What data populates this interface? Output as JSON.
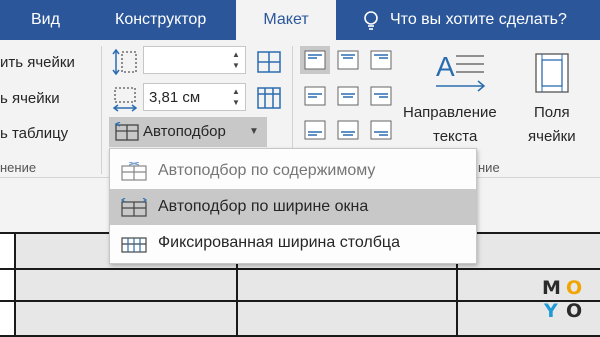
{
  "tabs": {
    "view": "Вид",
    "design": "Конструктор",
    "layout": "Макет",
    "tell_me": "Что вы хотите сделать?"
  },
  "ribbon": {
    "merge_cells": "ить ячейки",
    "split_cells": "ь ячейки",
    "split_table": "ь таблицу",
    "merge_group_label": "нение",
    "height_value": "",
    "width_value": "3,81 см",
    "autofit_label": "Автоподбор",
    "direction_line1": "Направление",
    "direction_line2": "текста",
    "margins_line1": "Поля",
    "margins_line2": "ячейки",
    "alignment_group_label": "ние"
  },
  "autofit_menu": {
    "items": [
      {
        "label": "Автоподбор по содержимому",
        "highlighted": false,
        "enabled": false
      },
      {
        "label": "Автоподбор по ширине окна",
        "highlighted": true,
        "enabled": true
      },
      {
        "label": "Фиксированная ширина столбца",
        "highlighted": false,
        "enabled": true
      }
    ]
  },
  "watermark": {
    "letters": [
      "M",
      "O",
      "Y",
      "O"
    ],
    "colors": [
      "#2b2b2b",
      "#f0a500",
      "#1e9bd7",
      "#2b2b2b"
    ]
  },
  "colors": {
    "tab_bar": "#2b579a",
    "ribbon_bg": "#f3f3f3",
    "highlight": "#c8c8c8",
    "icon_blue": "#2b6cb0"
  }
}
